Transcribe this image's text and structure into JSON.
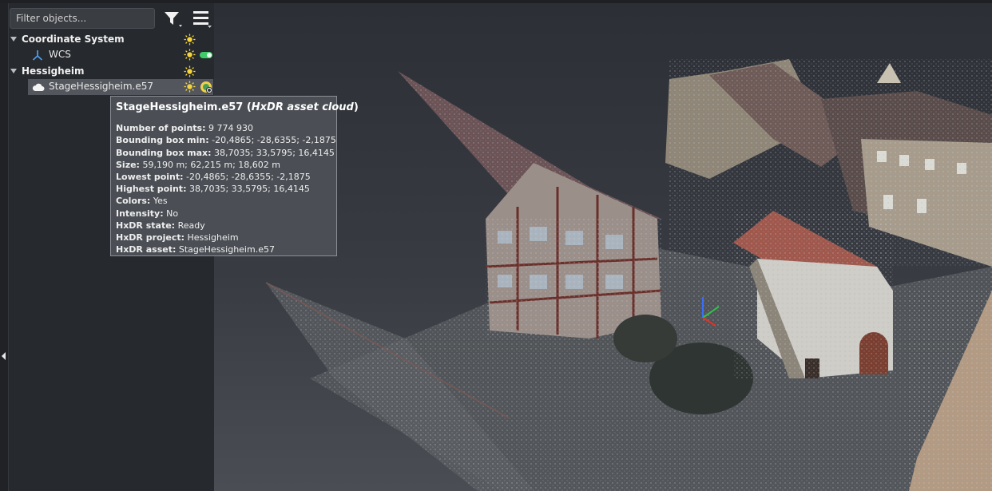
{
  "filter": {
    "placeholder": "Filter objects..."
  },
  "tree": {
    "groups": [
      {
        "label": "Coordinate System",
        "children": [
          {
            "label": "WCS"
          }
        ]
      },
      {
        "label": "Hessigheim",
        "children": [
          {
            "label": "StageHessigheim.e57"
          }
        ]
      }
    ]
  },
  "tooltip": {
    "name": "StageHessigheim.e57",
    "type_prefix": " (",
    "type": "HxDR asset cloud",
    "type_suffix": ")",
    "rows": [
      {
        "key": "Number of points:",
        "value": " 9 774 930"
      },
      {
        "key": "Bounding box min:",
        "value": " -20,4865; -28,6355; -2,1875"
      },
      {
        "key": "Bounding box max:",
        "value": " 38,7035; 33,5795; 16,4145"
      },
      {
        "key": "Size:",
        "value": " 59,190 m; 62,215 m; 18,602 m"
      },
      {
        "key": "Lowest point:",
        "value": " -20,4865; -28,6355; -2,1875"
      },
      {
        "key": "Highest point:",
        "value": " 38,7035; 33,5795; 16,4145"
      },
      {
        "key": "Colors:",
        "value": " Yes"
      },
      {
        "key": "Intensity:",
        "value": " No"
      },
      {
        "key": "HxDR state:",
        "value": " Ready"
      },
      {
        "key": "HxDR project:",
        "value": " Hessigheim"
      },
      {
        "key": "HxDR asset:",
        "value": " StageHessigheim.e57"
      }
    ]
  },
  "colors": {
    "visible_toggle": "#3fcb6a",
    "sun": "#f5d33c",
    "panel_bg": "#26292d",
    "selected_row": "#53575d"
  },
  "icons": {
    "filter": "funnel-icon",
    "menu": "hamburger-menu-icon",
    "visibility": "sun-icon",
    "coordinate_system": "axes-icon",
    "point_cloud": "cloud-icon"
  }
}
